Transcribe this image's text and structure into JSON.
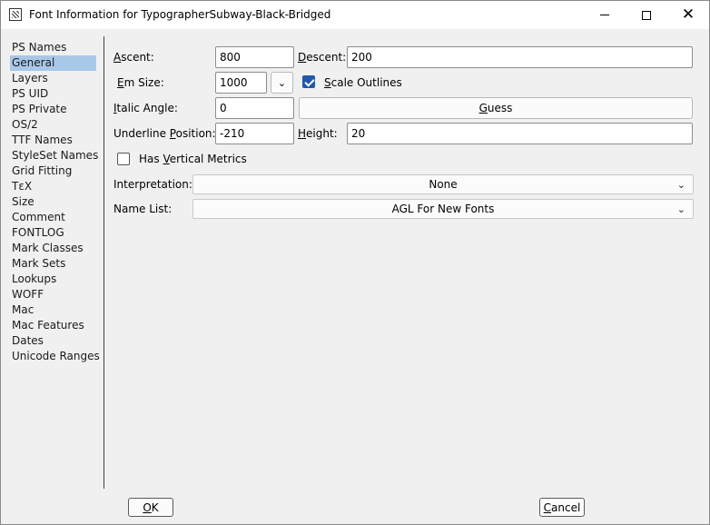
{
  "window": {
    "title": "Font Information for TypographerSubway-Black-Bridged",
    "icon": "fontforge-app-icon"
  },
  "sidebar": {
    "items": [
      {
        "label": "PS Names",
        "active": false
      },
      {
        "label": "General",
        "active": true
      },
      {
        "label": "Layers",
        "active": false
      },
      {
        "label": "PS UID",
        "active": false
      },
      {
        "label": "PS Private",
        "active": false
      },
      {
        "label": "OS/2",
        "active": false
      },
      {
        "label": "TTF Names",
        "active": false
      },
      {
        "label": "StyleSet Names",
        "active": false
      },
      {
        "label": "Grid Fitting",
        "active": false
      },
      {
        "label": "TεX",
        "active": false
      },
      {
        "label": "Size",
        "active": false
      },
      {
        "label": "Comment",
        "active": false
      },
      {
        "label": "FONTLOG",
        "active": false
      },
      {
        "label": "Mark Classes",
        "active": false
      },
      {
        "label": "Mark Sets",
        "active": false
      },
      {
        "label": "Lookups",
        "active": false
      },
      {
        "label": "WOFF",
        "active": false
      },
      {
        "label": "Mac",
        "active": false
      },
      {
        "label": "Mac Features",
        "active": false
      },
      {
        "label": "Dates",
        "active": false
      },
      {
        "label": "Unicode Ranges",
        "active": false
      }
    ]
  },
  "general": {
    "ascent_label_u": "A",
    "ascent_label_rest": "scent:",
    "ascent_value": "800",
    "descent_label_u": "D",
    "descent_label_rest": "escent:",
    "descent_value": "200",
    "emsize_label_u": "E",
    "emsize_label_rest": "m Size:",
    "emsize_value": "1000",
    "scale_outlines_u": "S",
    "scale_outlines_rest": "cale Outlines",
    "scale_outlines_checked": true,
    "italic_angle_label_u": "I",
    "italic_angle_label_rest": "talic Angle:",
    "italic_angle_value": "0",
    "guess_button_u": "G",
    "guess_button_rest": "uess",
    "underline_pos_label_pre": "Underline ",
    "underline_pos_label_u": "P",
    "underline_pos_label_rest": "osition:",
    "underline_pos_value": "-210",
    "height_label_u": "H",
    "height_label_rest": "eight:",
    "height_value": "20",
    "vertical_metrics_pre": "Has ",
    "vertical_metrics_u": "V",
    "vertical_metrics_rest": "ertical Metrics",
    "vertical_metrics_checked": false,
    "interpretation_label": "Interpretation:",
    "interpretation_value": "None",
    "namelist_label": "Name List:",
    "namelist_value": "AGL For New Fonts"
  },
  "footer": {
    "ok_u": "O",
    "ok_rest": "K",
    "cancel_u": "C",
    "cancel_rest": "ancel"
  }
}
